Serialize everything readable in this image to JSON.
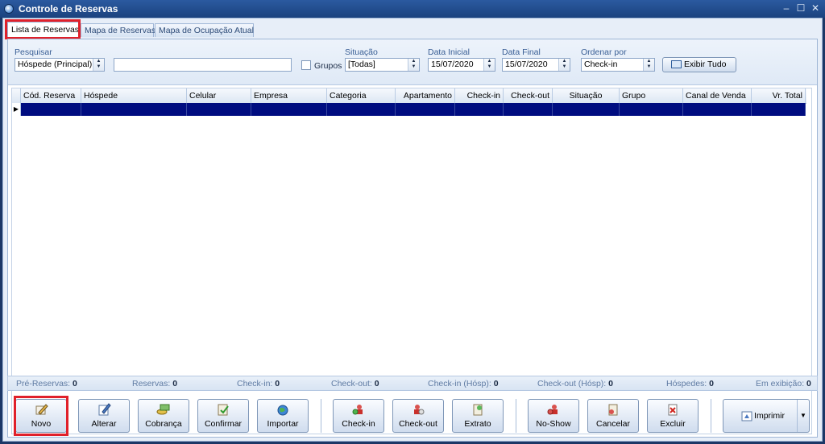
{
  "window": {
    "title": "Controle de Reservas",
    "controls": [
      "–",
      "☐",
      "✕"
    ]
  },
  "tabs": [
    {
      "label": "Lista de Reservas",
      "active": true
    },
    {
      "label": "Mapa de Reservas",
      "active": false
    },
    {
      "label": "Mapa de Ocupação Atual",
      "active": false
    }
  ],
  "filters": {
    "pesquisar_label": "Pesquisar",
    "pesquisar_value": "Hóspede (Principal)",
    "search_value": "",
    "grupos_label": "Grupos",
    "situacao_label": "Situação",
    "situacao_value": "[Todas]",
    "data_inicial_label": "Data Inicial",
    "data_inicial_value": "15/07/2020",
    "data_final_label": "Data Final",
    "data_final_value": "15/07/2020",
    "ordenar_label": "Ordenar por",
    "ordenar_value": "Check-in",
    "exibir_tudo_label": "Exibir Tudo"
  },
  "grid": {
    "columns": [
      "Cód. Reserva",
      "Hóspede",
      "Celular",
      "Empresa",
      "Categoria",
      "Apartamento",
      "Check-in",
      "Check-out",
      "Situação",
      "Grupo",
      "Canal de Venda",
      "Vr. Total"
    ],
    "selected_row_color": "#000c80"
  },
  "status": {
    "pre_reservas_label": "Pré-Reservas:",
    "pre_reservas": "0",
    "reservas_label": "Reservas:",
    "reservas": "0",
    "checkin_label": "Check-in:",
    "checkin": "0",
    "checkout_label": "Check-out:",
    "checkout": "0",
    "checkin_hosp_label": "Check-in (Hósp):",
    "checkin_hosp": "0",
    "checkout_hosp_label": "Check-out (Hósp):",
    "checkout_hosp": "0",
    "hospedes_label": "Hóspedes:",
    "hospedes": "0",
    "em_exibicao_label": "Em exibição:",
    "em_exibicao": "0"
  },
  "toolbar": {
    "novo": "Novo",
    "alterar": "Alterar",
    "cobranca": "Cobrança",
    "confirmar": "Confirmar",
    "importar": "Importar",
    "checkin": "Check-in",
    "checkout": "Check-out",
    "extrato": "Extrato",
    "noshow": "No-Show",
    "cancelar": "Cancelar",
    "excluir": "Excluir",
    "imprimir": "Imprimir"
  },
  "colors": {
    "highlight": "#e0202a",
    "titlebar": "#2b5aa0",
    "accent": "#3a5f95"
  }
}
